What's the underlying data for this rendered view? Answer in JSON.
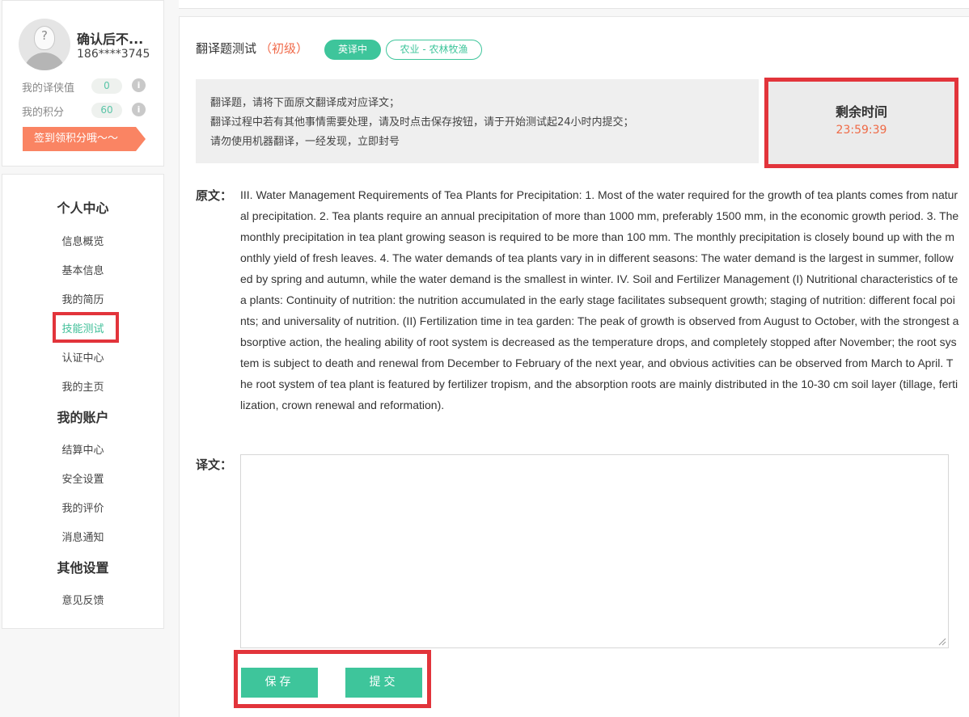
{
  "profile": {
    "name": "确认后不...",
    "phone": "186****3745",
    "stats": [
      {
        "label": "我的译侠值",
        "value": "0"
      },
      {
        "label": "我的积分",
        "value": "60"
      }
    ],
    "sign_button": "签到领积分哦～～"
  },
  "nav": {
    "sections": [
      {
        "title": "个人中心",
        "items": [
          "信息概览",
          "基本信息",
          "我的简历",
          "技能测试",
          "认证中心",
          "我的主页"
        ]
      },
      {
        "title": "我的账户",
        "items": [
          "结算中心",
          "安全设置",
          "我的评价",
          "消息通知"
        ]
      },
      {
        "title": "其他设置",
        "items": [
          "意见反馈"
        ]
      }
    ],
    "active_item": "技能测试"
  },
  "test": {
    "title": "翻译题测试",
    "level": "（初级）",
    "language_tag": "英译中",
    "domain_tag": "农业 - 农林牧渔",
    "notice": [
      "翻译题，请将下面原文翻译成对应译文；",
      "翻译过程中若有其他事情需要处理，请及时点击保存按钮，请于开始测试起24小时内提交；",
      "请勿使用机器翻译，一经发现，立即封号"
    ],
    "timer_label": "剩余时间",
    "timer_value": "23:59:39",
    "source_label": "原文：",
    "source_text": "III. Water Management Requirements of Tea Plants for Precipitation: 1. Most of the water required for the growth of tea plants comes from natural precipitation. 2. Tea plants require an annual precipitation of more than 1000 mm, preferably 1500 mm, in the economic growth period. 3. The monthly precipitation in tea plant growing season is required to be more than 100 mm. The monthly precipitation is closely bound up with the monthly yield of fresh leaves. 4. The water demands of tea plants vary in in different seasons: The water demand is the largest in summer, followed by spring and autumn, while the water demand is the smallest in winter. IV. Soil and Fertilizer Management (I) Nutritional characteristics of tea plants: Continuity of nutrition: the nutrition accumulated in the early stage facilitates subsequent growth; staging of nutrition: different focal points; and universality of nutrition. (II) Fertilization time in tea garden: The peak of growth is observed from August to October, with the strongest absorptive action, the healing ability of root system is decreased as the temperature drops, and completely stopped after November; the root system is subject to death and renewal from December to February of the next year, and obvious activities can be observed from March to April. The root system of tea plant is featured by fertilizer tropism, and the absorption roots are mainly distributed in the 10-30 cm soil layer (tillage, fertilization, crown renewal and reformation).",
    "translation_label": "译文：",
    "translation_value": "",
    "save_label": "保存",
    "submit_label": "提交"
  }
}
